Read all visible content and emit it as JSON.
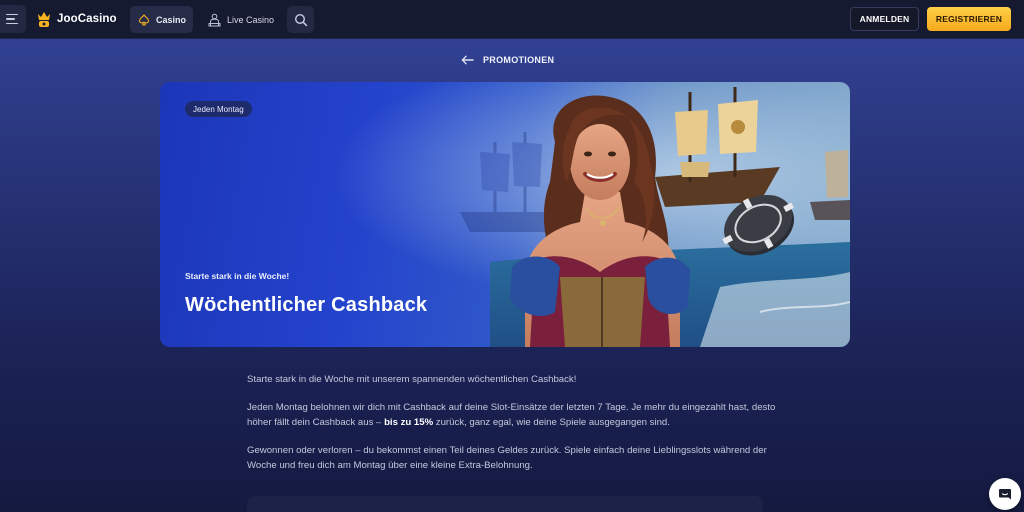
{
  "header": {
    "logo_text": "JooCasino",
    "nav": {
      "casino_label": "Casino",
      "live_casino_label": "Live Casino"
    },
    "login_label": "ANMELDEN",
    "register_label": "REGISTRIEREN"
  },
  "breadcrumb": {
    "back_label": "PROMOTIONEN"
  },
  "hero": {
    "badge": "Jeden Montag",
    "kicker": "Starte stark in die Woche!",
    "title": "Wöchentlicher Cashback"
  },
  "content": {
    "intro": "Starte stark in die Woche mit unserem spannenden wöchentlichen Cashback!",
    "para2_before": "Jeden Montag belohnen wir dich mit Cashback auf deine Slot-Einsätze der letzten 7 Tage. Je mehr du eingezahlt hast, desto höher fällt dein Cashback aus – ",
    "para2_bold": "bis zu 15%",
    "para2_after": " zurück, ganz egal, wie deine Spiele ausgegangen sind.",
    "para3": "Gewonnen oder verloren – du bekommst einen Teil deines Geldes zurück. Spiele einfach deine Lieblingsslots während der Woche und freu dich am Montag über eine kleine Extra-Belohnung."
  },
  "icons": {
    "menu": "hamburger-menu-icon",
    "logo": "crown-logo-icon",
    "casino": "spade-icon",
    "live_casino": "dealer-icon",
    "search": "search-icon",
    "back": "arrow-left-icon",
    "chat": "chat-bubble-icon"
  },
  "colors": {
    "header_bg": "#161a31",
    "accent_yellow": "#f5a91c",
    "hero_blue": "#2443cc"
  }
}
